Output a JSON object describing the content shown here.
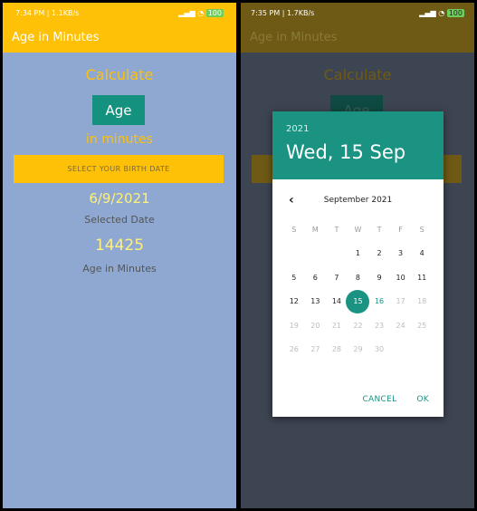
{
  "left": {
    "status": {
      "time": "7:34 PM | 1.1KB/s",
      "icons": "alarm-icon",
      "battery": "100"
    },
    "app_title": "Age in Minutes",
    "calculate_label": "Calculate",
    "age_label": "Age",
    "in_minutes_label": "in minutes",
    "select_button": "SELECT YOUR BIRTH DATE",
    "selected_date_value": "6/9/2021",
    "selected_date_label": "Selected Date",
    "minutes_value": "14425",
    "minutes_label": "Age in Minutes"
  },
  "right": {
    "status": {
      "time": "7:35 PM | 1.7KB/s",
      "battery": "100"
    },
    "app_title": "Age in Minutes",
    "calculate_label": "Calculate",
    "age_label": "Age",
    "dialog": {
      "year": "2021",
      "date": "Wed, 15 Sep",
      "month_title": "September 2021",
      "weekdays": [
        "S",
        "M",
        "T",
        "W",
        "T",
        "F",
        "S"
      ],
      "weeks": [
        [
          "",
          "",
          "",
          "1",
          "2",
          "3",
          "4"
        ],
        [
          "5",
          "6",
          "7",
          "8",
          "9",
          "10",
          "11"
        ],
        [
          "12",
          "13",
          "14",
          "15",
          "16",
          "17",
          "18"
        ],
        [
          "19",
          "20",
          "21",
          "22",
          "23",
          "24",
          "25"
        ],
        [
          "26",
          "27",
          "28",
          "29",
          "30",
          "",
          ""
        ]
      ],
      "selected_day": "15",
      "cancel_label": "CANCEL",
      "ok_label": "OK"
    }
  },
  "colors": {
    "accent_yellow": "#ffc107",
    "teal": "#1a9382",
    "bg_blue": "#8ea8d1"
  }
}
